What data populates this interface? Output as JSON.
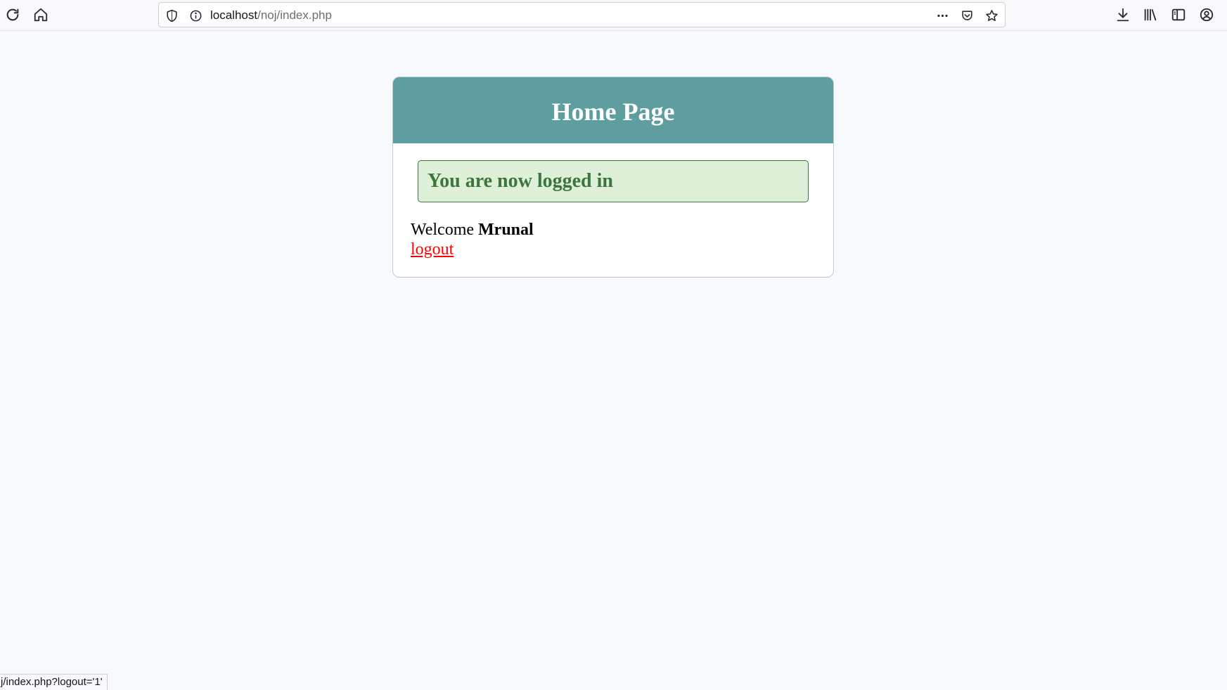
{
  "browser": {
    "url_host": "localhost",
    "url_path": "/noj/index.php",
    "status_text": "j/index.php?logout='1'"
  },
  "page": {
    "title": "Home Page",
    "success_message": "You are now logged in",
    "welcome_label": "Welcome ",
    "username": "Mrunal",
    "logout_label": "logout"
  },
  "colors": {
    "header_bg": "#5f9ea0",
    "success_bg": "#dff0d8",
    "success_text": "#3c763d",
    "logout_link": "#ff0000"
  }
}
